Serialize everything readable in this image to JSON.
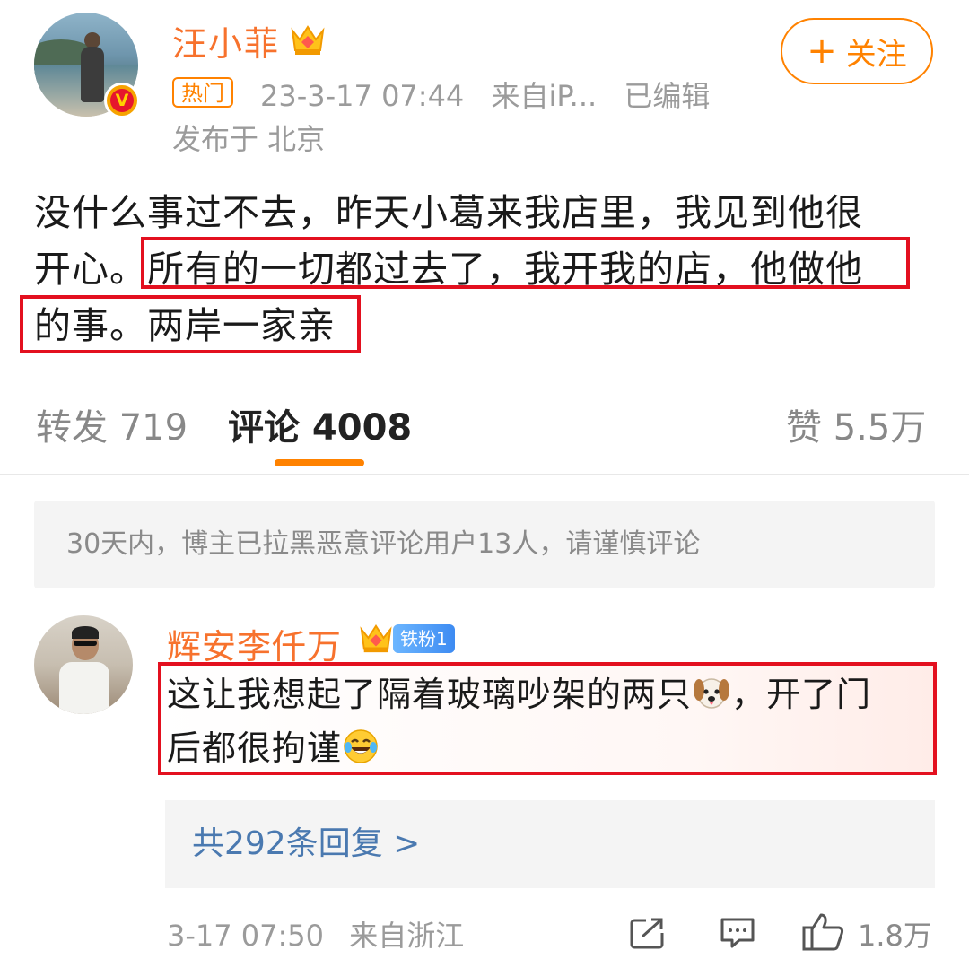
{
  "post": {
    "author": "汪小菲",
    "follow_label": "关注",
    "follow_plus": "+",
    "hot_badge": "热门",
    "timestamp": "23-3-17 07:44",
    "source": "来自iP...",
    "edited": "已编辑",
    "location": "发布于 北京",
    "text_line1": "没什么事过不去，昨天小葛来我店里，我见到他很",
    "text_line2": "开心。所有的一切都过去了，我开我的店，他做他",
    "text_line3": "的事。两岸一家亲"
  },
  "tabs": {
    "repost": "转发 719",
    "comment": "评论 4008",
    "like": "赞 5.5万"
  },
  "notice": "30天内，博主已拉黑恶意评论用户13人，请谨慎评论",
  "comment": {
    "author": "辉安李仟万",
    "fan_badge": "铁粉1",
    "text_part1": "这让我想起了隔着玻璃吵架的两只",
    "text_part2": "，开了门",
    "text_part3": "后都很拘谨",
    "replies": "共292条回复 >",
    "time": "3-17 07:50",
    "source": "来自浙江",
    "like_count": "1.8万"
  },
  "colors": {
    "accent": "#ff8200",
    "name": "#f7722d",
    "highlight_box": "#e3101f",
    "link": "#4a79b0"
  },
  "icons": [
    "crown-icon",
    "verified-v-icon",
    "dog-emoji-icon",
    "laugh-cry-emoji-icon",
    "share-icon",
    "comment-icon",
    "thumbs-up-icon"
  ]
}
